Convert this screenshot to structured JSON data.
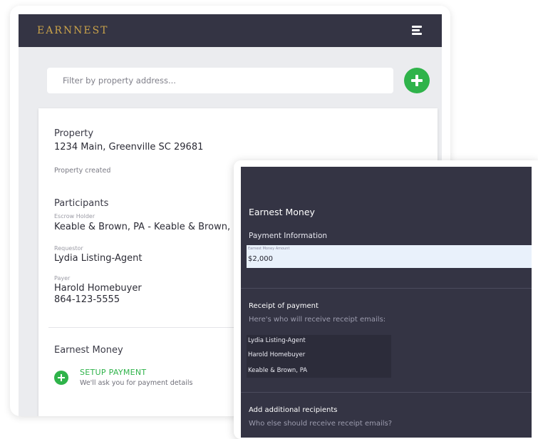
{
  "header": {
    "logo": "EARNNEST"
  },
  "filter": {
    "placeholder": "Filter by property address..."
  },
  "property": {
    "heading": "Property",
    "address": "1234 Main, Greenville SC 29681",
    "status": "Property created"
  },
  "participants": {
    "heading": "Participants",
    "escrow_label": "Escrow Holder",
    "escrow_value": "Keable & Brown, PA - Keable & Brown, PA",
    "requestor_label": "Requestor",
    "requestor_value": "Lydia Listing-Agent",
    "payer_label": "Payer",
    "payer_name": "Harold Homebuyer",
    "payer_phone": "864-123-5555"
  },
  "earnest_money": {
    "heading": "Earnest Money",
    "setup_label": "SETUP PAYMENT",
    "setup_sub": "We'll ask you for payment details"
  },
  "panel": {
    "title": "Earnest Money",
    "payment_info": "Payment Information",
    "amount_label": "Earnest Money Amount",
    "amount_value": "$2,000",
    "receipt_title": "Receipt of payment",
    "receipt_sub": "Here's who will receive receipt emails:",
    "recipients": [
      "Lydia Listing-Agent",
      "Harold Homebuyer",
      "Keable & Brown, PA"
    ],
    "additional_title": "Add additional recipients",
    "additional_sub": "Who else should receive receipt emails?"
  },
  "colors": {
    "header_bg": "#343444",
    "brand_gold": "#c9a24a",
    "accent_green": "#2fb34a"
  },
  "icons": {
    "menu": "hamburger-icon",
    "add": "plus-circle-icon"
  }
}
